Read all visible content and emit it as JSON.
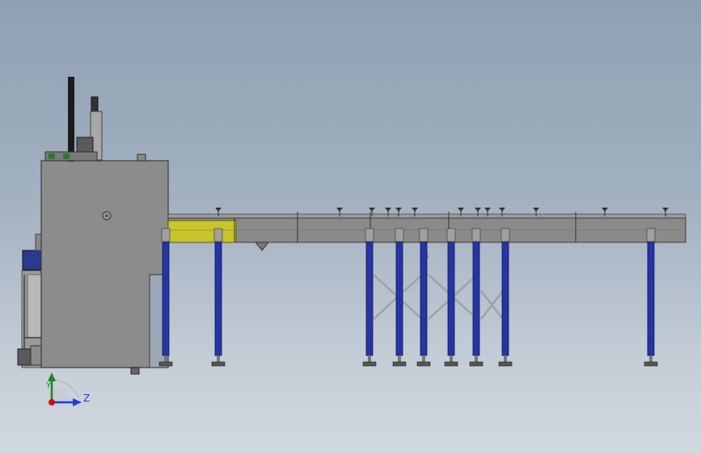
{
  "viewport": {
    "background_top": "#8fa0b3",
    "background_bottom": "#d2d8df"
  },
  "triad": {
    "z_label": "Z",
    "y_label": "Y",
    "z_color": "#1c3fd0",
    "y_color": "#1a8a1a",
    "origin_color": "#d01010"
  },
  "colors": {
    "cabinet": "#8c8c8c",
    "conveyor": "#8a8a8a",
    "infeed_section": "#c9c52a",
    "legs": "#2634a6",
    "braces": "#a0a0a8",
    "motor": "#c81818",
    "hopper": "#2a3b8c"
  },
  "icons": {
    "origin": "origin-sphere-icon",
    "z_arrow": "z-axis-arrow-icon",
    "y_arrow": "y-axis-arrow-icon"
  }
}
